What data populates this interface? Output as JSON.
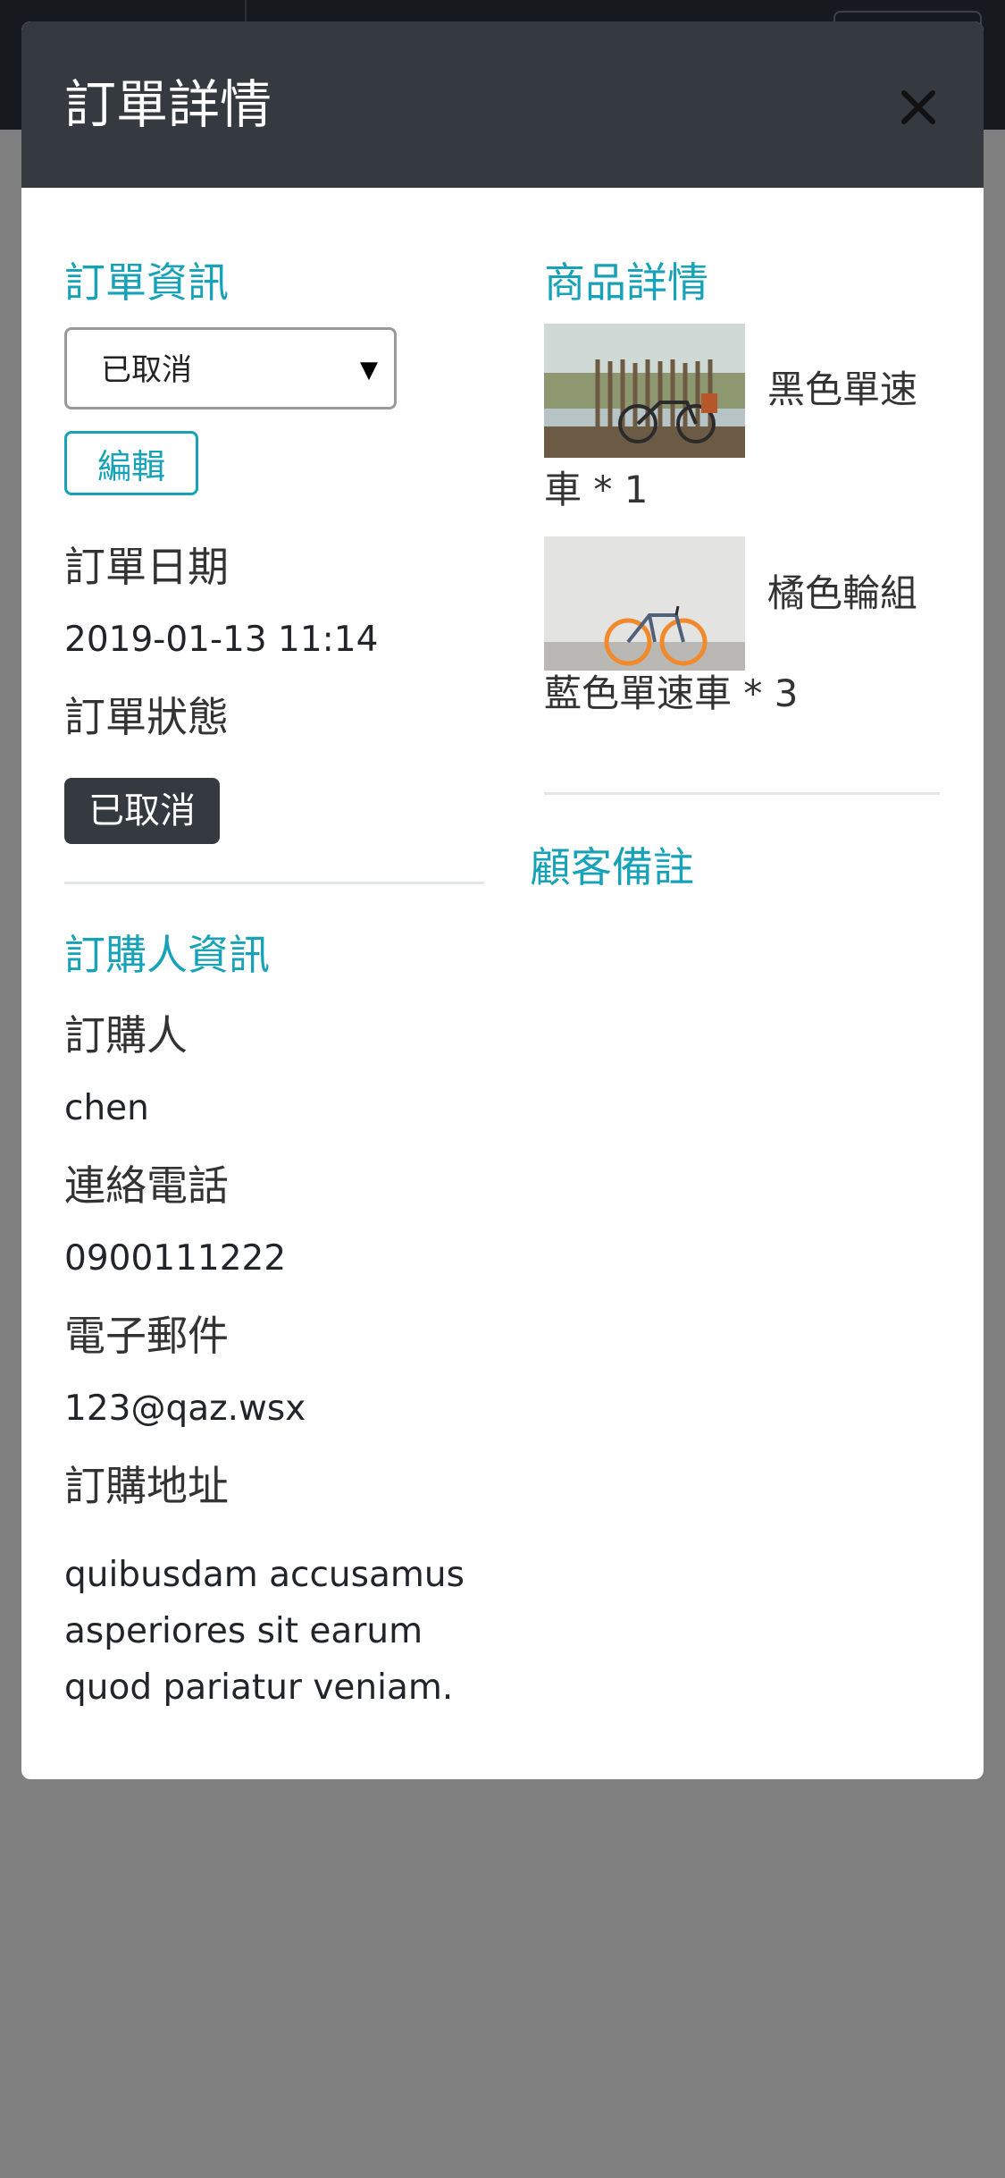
{
  "modal": {
    "title": "訂單詳情",
    "close_icon": "close-icon"
  },
  "order_info": {
    "title": "訂單資訊",
    "status_select_value": "已取消",
    "edit_label": "編輯",
    "date_label": "訂單日期",
    "date_value": "2019-01-13 11:14",
    "status_label": "訂單狀態",
    "status_badge": "已取消"
  },
  "buyer_info": {
    "title": "訂購人資訊",
    "buyer_label": "訂購人",
    "buyer_value": "chen",
    "phone_label": "連絡電話",
    "phone_value": "0900111222",
    "email_label": "電子郵件",
    "email_value": "123@qaz.wsx",
    "address_label": "訂購地址",
    "address_value": "quibusdam accusamus asperiores sit earum quod pariatur veniam."
  },
  "products": {
    "title": "商品詳情",
    "items": [
      {
        "name_line1": "黑色單速",
        "name_line2": "車 * 1"
      },
      {
        "name_line1": "橘色輪組",
        "name_line2": "藍色單速車 * 3"
      }
    ]
  },
  "notes": {
    "title": "顧客備註"
  },
  "colors": {
    "accent": "#17a2b8",
    "header_bg": "#343a40",
    "badge_bg": "#343a40",
    "backdrop": "#808080"
  }
}
